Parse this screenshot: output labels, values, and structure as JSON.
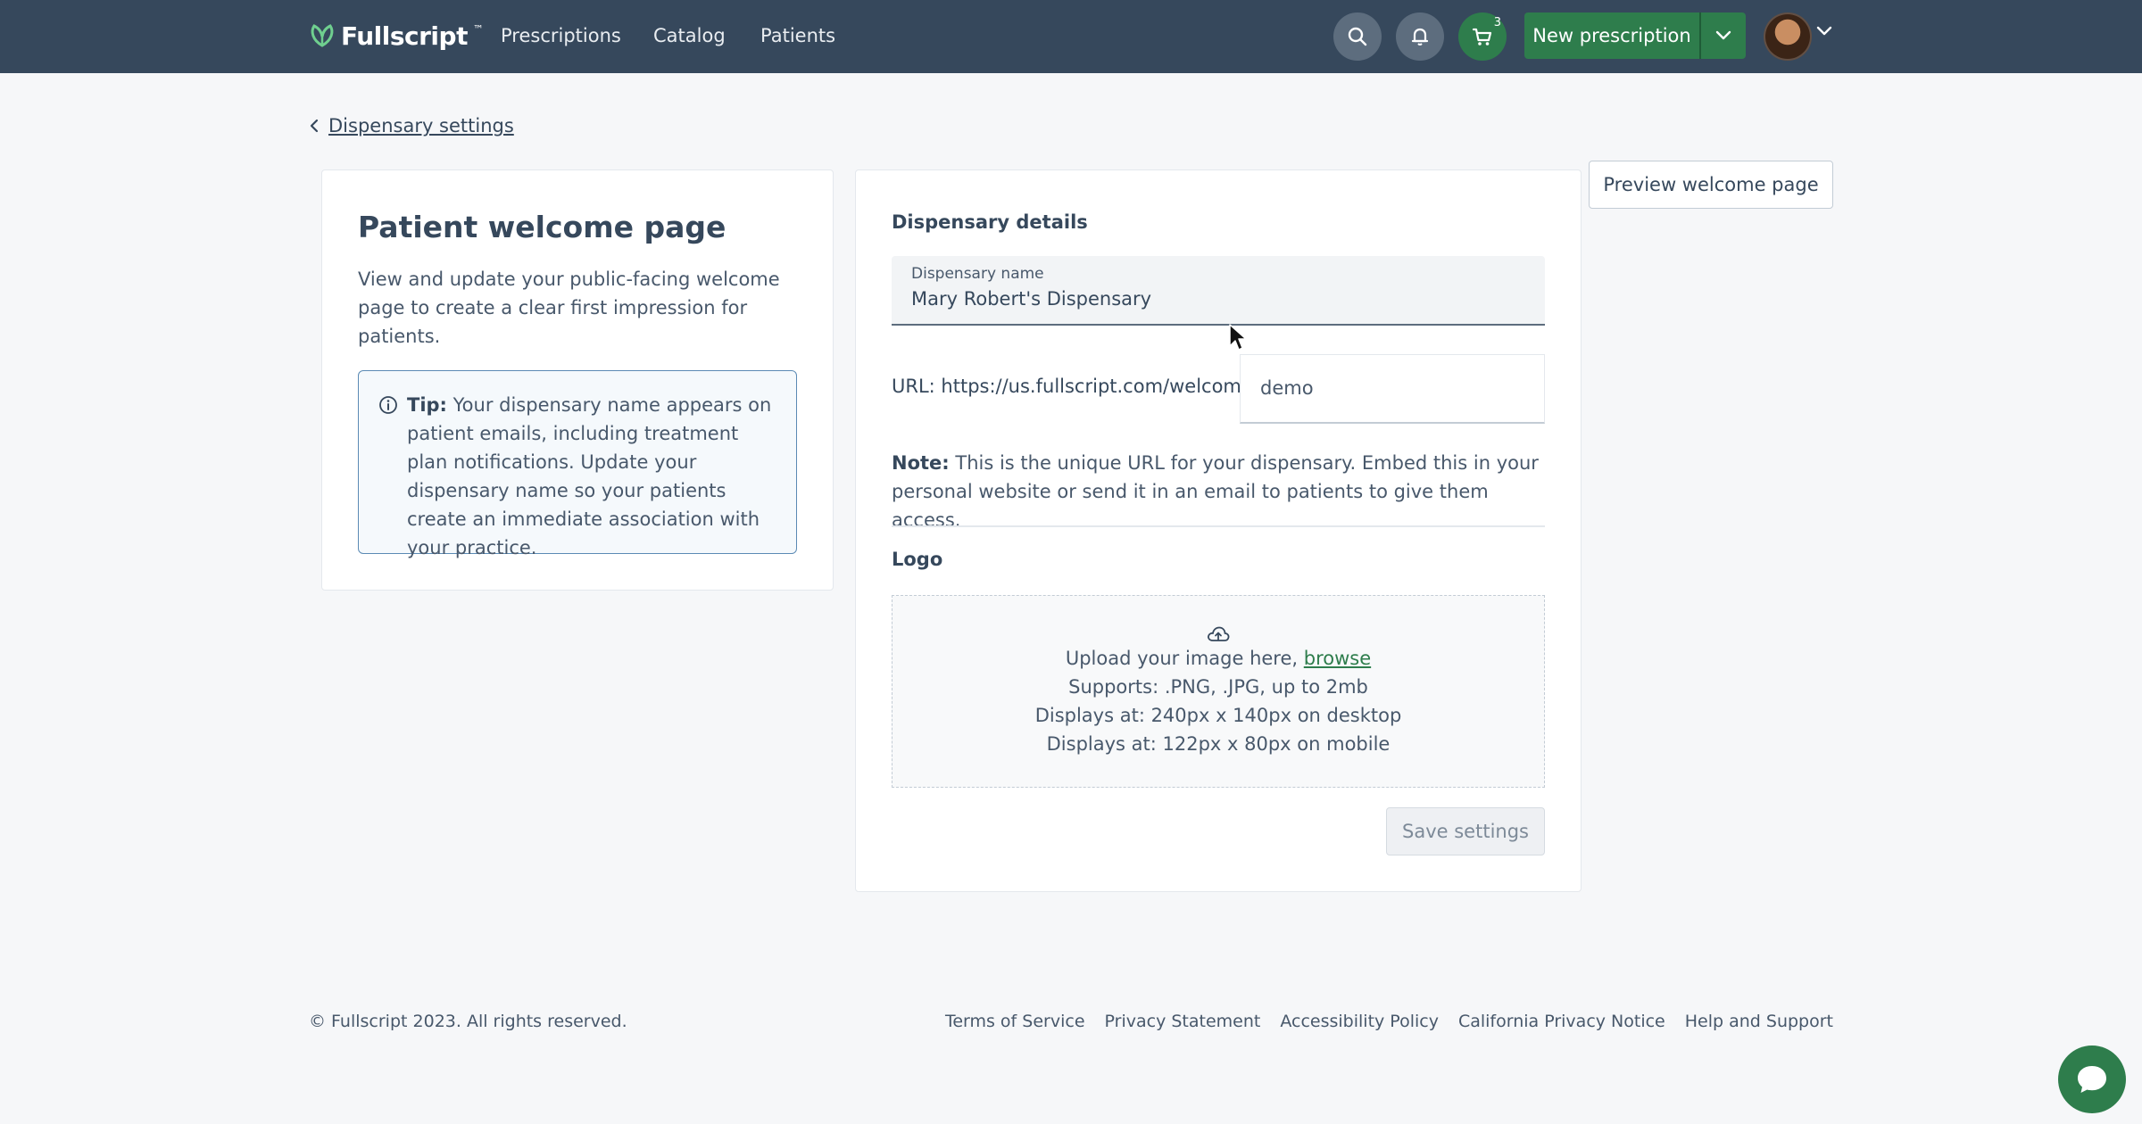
{
  "brand": {
    "name": "Fullscript",
    "trademark": "™"
  },
  "nav": {
    "links": [
      "Prescriptions",
      "Catalog",
      "Patients"
    ],
    "cart_count": "3",
    "new_prescription": "New prescription"
  },
  "back_link": "Dispensary settings",
  "left_panel": {
    "title": "Patient welcome page",
    "description": "View and update your public-facing welcome page to create a clear first impression for patients.",
    "tip_label": "Tip:",
    "tip_text": " Your dispensary name appears on patient emails, including treatment plan notifications. Update your dispensary name so your patients create an immediate association with your practice."
  },
  "right_panel": {
    "section_title": "Dispensary details",
    "name_field": {
      "label": "Dispensary name",
      "value": "Mary Robert's Dispensary"
    },
    "url_label": "URL: https://us.fullscript.com/welcome/",
    "url_slug": "demo",
    "note_label": "Note:",
    "note_text": " This is the unique URL for your dispensary. Embed this in your personal website or send it in an email to patients to give them access.",
    "logo_title": "Logo",
    "upload_text": "Upload your image here, ",
    "upload_browse": "browse",
    "upload_supports": "Supports: .PNG, .JPG, up to 2mb",
    "upload_desktop": "Displays at: 240px x 140px on desktop",
    "upload_mobile": "Displays at: 122px x 80px on mobile",
    "save_button": "Save settings"
  },
  "preview_button": "Preview welcome page",
  "footer": {
    "copyright": "© Fullscript 2023. All rights reserved.",
    "links": [
      "Terms of Service",
      "Privacy Statement",
      "Accessibility Policy",
      "California Privacy Notice",
      "Help and Support"
    ]
  },
  "colors": {
    "nav_bg": "#36485c",
    "primary_green": "#2e7d4c",
    "tip_border": "#5b8ab4"
  }
}
